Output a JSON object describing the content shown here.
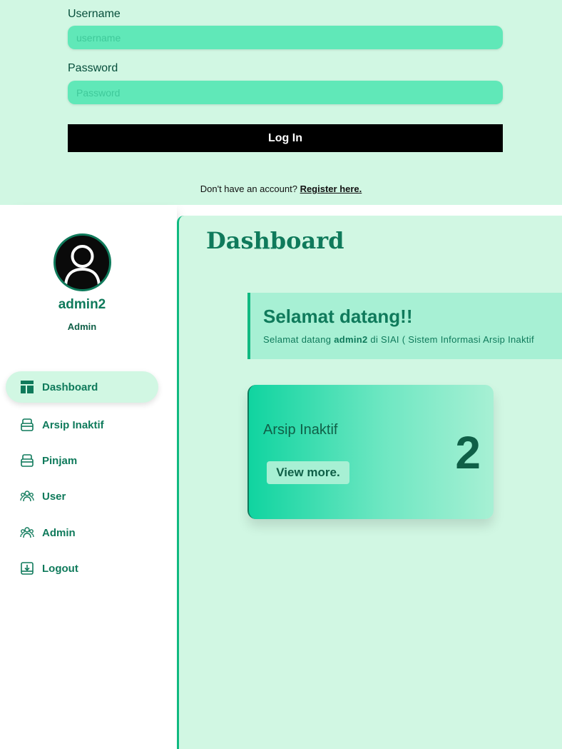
{
  "login": {
    "username_label": "Username",
    "username_placeholder": "username",
    "password_label": "Password",
    "password_placeholder": "Password",
    "login_button": "Log In",
    "register_prompt": "Don't have an account?",
    "register_link": "Register here."
  },
  "sidebar": {
    "username": "admin2",
    "role": "Admin",
    "items": [
      {
        "label": "Dashboard",
        "icon": "dashboard-icon",
        "active": true
      },
      {
        "label": "Arsip Inaktif",
        "icon": "archive-icon",
        "active": false
      },
      {
        "label": "Pinjam",
        "icon": "archive-icon",
        "active": false
      },
      {
        "label": "User",
        "icon": "users-icon",
        "active": false
      },
      {
        "label": "Admin",
        "icon": "users-icon",
        "active": false
      },
      {
        "label": "Logout",
        "icon": "logout-icon",
        "active": false
      }
    ]
  },
  "main": {
    "title": "Dashboard",
    "welcome_heading": "Selamat datang!!",
    "welcome_prefix": "Selamat datang ",
    "welcome_user": "admin2",
    "welcome_suffix": " di SIAI ( Sistem Informasi Arsip Inaktif",
    "card": {
      "title": "Arsip Inaktif",
      "count": "2",
      "button": "View more."
    }
  },
  "colors": {
    "accent": "#0f7a5b",
    "light_green": "#d1f7e3",
    "input_green": "#60e8b8"
  }
}
